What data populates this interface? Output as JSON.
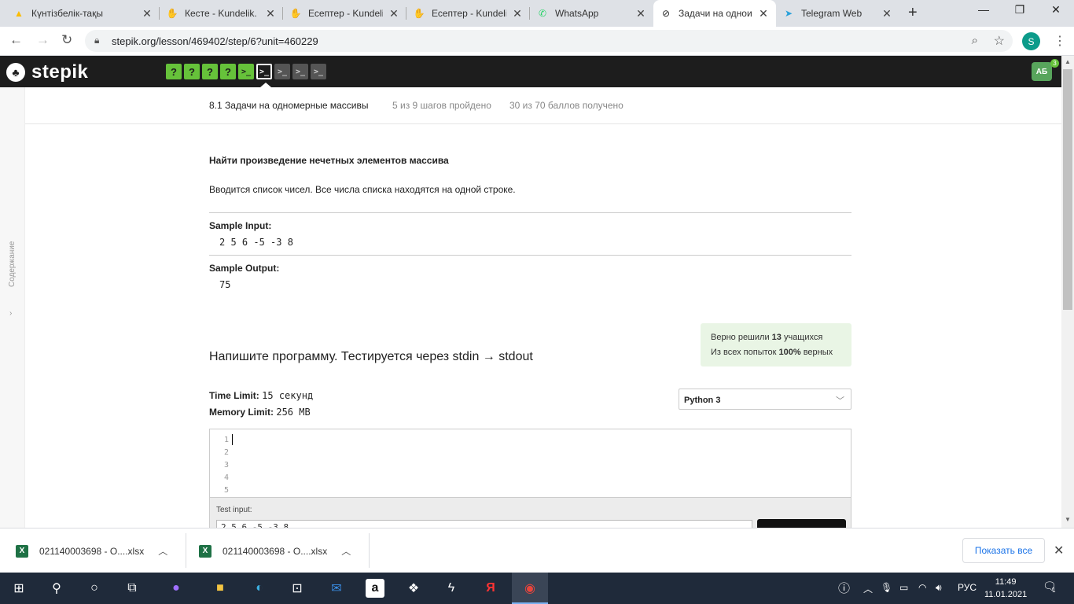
{
  "browser": {
    "tabs": [
      {
        "title": "Күнтізбелік-тақы",
        "icon": "google-drive-icon",
        "color": "#fbbc04"
      },
      {
        "title": "Кесте - Kundelik.",
        "icon": "kundelik-icon",
        "color": "#4a8cd8"
      },
      {
        "title": "Есептер - Kundelik",
        "icon": "kundelik-icon",
        "color": "#4a8cd8"
      },
      {
        "title": "Есептер - Kundelik",
        "icon": "kundelik-icon",
        "color": "#4a8cd8"
      },
      {
        "title": "WhatsApp",
        "icon": "whatsapp-icon",
        "color": "#25d366"
      },
      {
        "title": "Задачи на однои",
        "icon": "stepik-icon",
        "color": "#222222"
      },
      {
        "title": "Telegram Web",
        "icon": "telegram-icon",
        "color": "#2aa1da"
      }
    ],
    "url": "stepik.org/lesson/469402/step/6?unit=460229",
    "profile_letter": "S"
  },
  "stepik": {
    "logo_text": "stepik",
    "steps": [
      "?",
      "?",
      "?",
      "?",
      ">_",
      ">_",
      ">_",
      ">_",
      ">_"
    ],
    "avatar_initials": "АБ",
    "avatar_badge": "3",
    "sidebar_label": "Содержание",
    "lesson": {
      "title": "8.1 Задачи на одномерные массивы",
      "progress_steps": "5 из 9 шагов пройдено",
      "progress_points": "30 из 70 баллов  получено"
    },
    "problem": {
      "title": "Найти произведение нечетных элементов массива",
      "description": "Вводится список чисел. Все числа списка находятся на одной строке.",
      "sample_input_label": "Sample Input:",
      "sample_input": "2 5 6 -5 -3 8",
      "sample_output_label": "Sample Output:",
      "sample_output": "75"
    },
    "stats": {
      "solved_pre": "Верно решили ",
      "solved_num": "13",
      "solved_post": " учащихся",
      "attempts_pre": "Из всех попыток ",
      "attempts_num": "100%",
      "attempts_post": " верных"
    },
    "task_heading": "Напишите программу. Тестируется через stdin → stdout",
    "time_limit_label": "Time Limit:",
    "time_limit_value": "15 секунд",
    "memory_limit_label": "Memory Limit:",
    "memory_limit_value": "256 MB",
    "language": "Python 3",
    "editor_lines": [
      "1",
      "2",
      "3",
      "4",
      "5"
    ],
    "test_input_label": "Test input:",
    "test_input_value": "2 5 6 -5 -3 8"
  },
  "downloads": {
    "items": [
      "021140003698 - О....xlsx",
      "021140003698 - О....xlsx"
    ],
    "show_all": "Показать все"
  },
  "taskbar": {
    "lang": "РУС",
    "time": "11:49",
    "date": "11.01.2021",
    "notif_count": "1"
  }
}
